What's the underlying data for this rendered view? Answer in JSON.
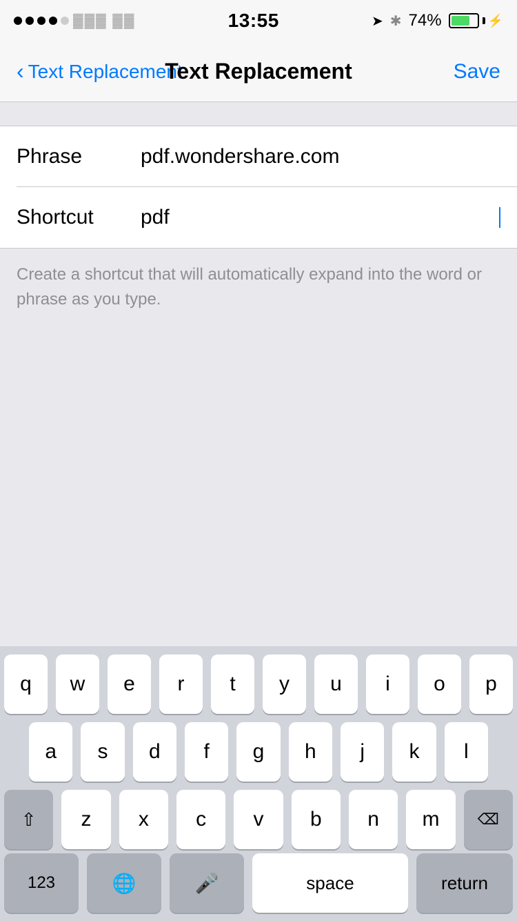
{
  "statusBar": {
    "time": "13:55",
    "carrier": "●●●●●",
    "batteryPercent": "74%",
    "locationArrow": "➤",
    "bluetooth": "*"
  },
  "navBar": {
    "backLabel": "Text Replacement",
    "title": "Text Replacement",
    "saveLabel": "Save"
  },
  "form": {
    "phraseLabel": "Phrase",
    "phraseValue": "pdf.wondershare.com",
    "shortcutLabel": "Shortcut",
    "shortcutValue": "pdf",
    "helperText": "Create a shortcut that will automatically expand into the word or phrase as you type."
  },
  "keyboard": {
    "row1": [
      "q",
      "w",
      "e",
      "r",
      "t",
      "y",
      "u",
      "i",
      "o",
      "p"
    ],
    "row2": [
      "a",
      "s",
      "d",
      "f",
      "g",
      "h",
      "j",
      "k",
      "l"
    ],
    "row3": [
      "z",
      "x",
      "c",
      "v",
      "b",
      "n",
      "m"
    ],
    "bottomRow": {
      "numbers": "123",
      "space": "space",
      "return": "return"
    }
  }
}
